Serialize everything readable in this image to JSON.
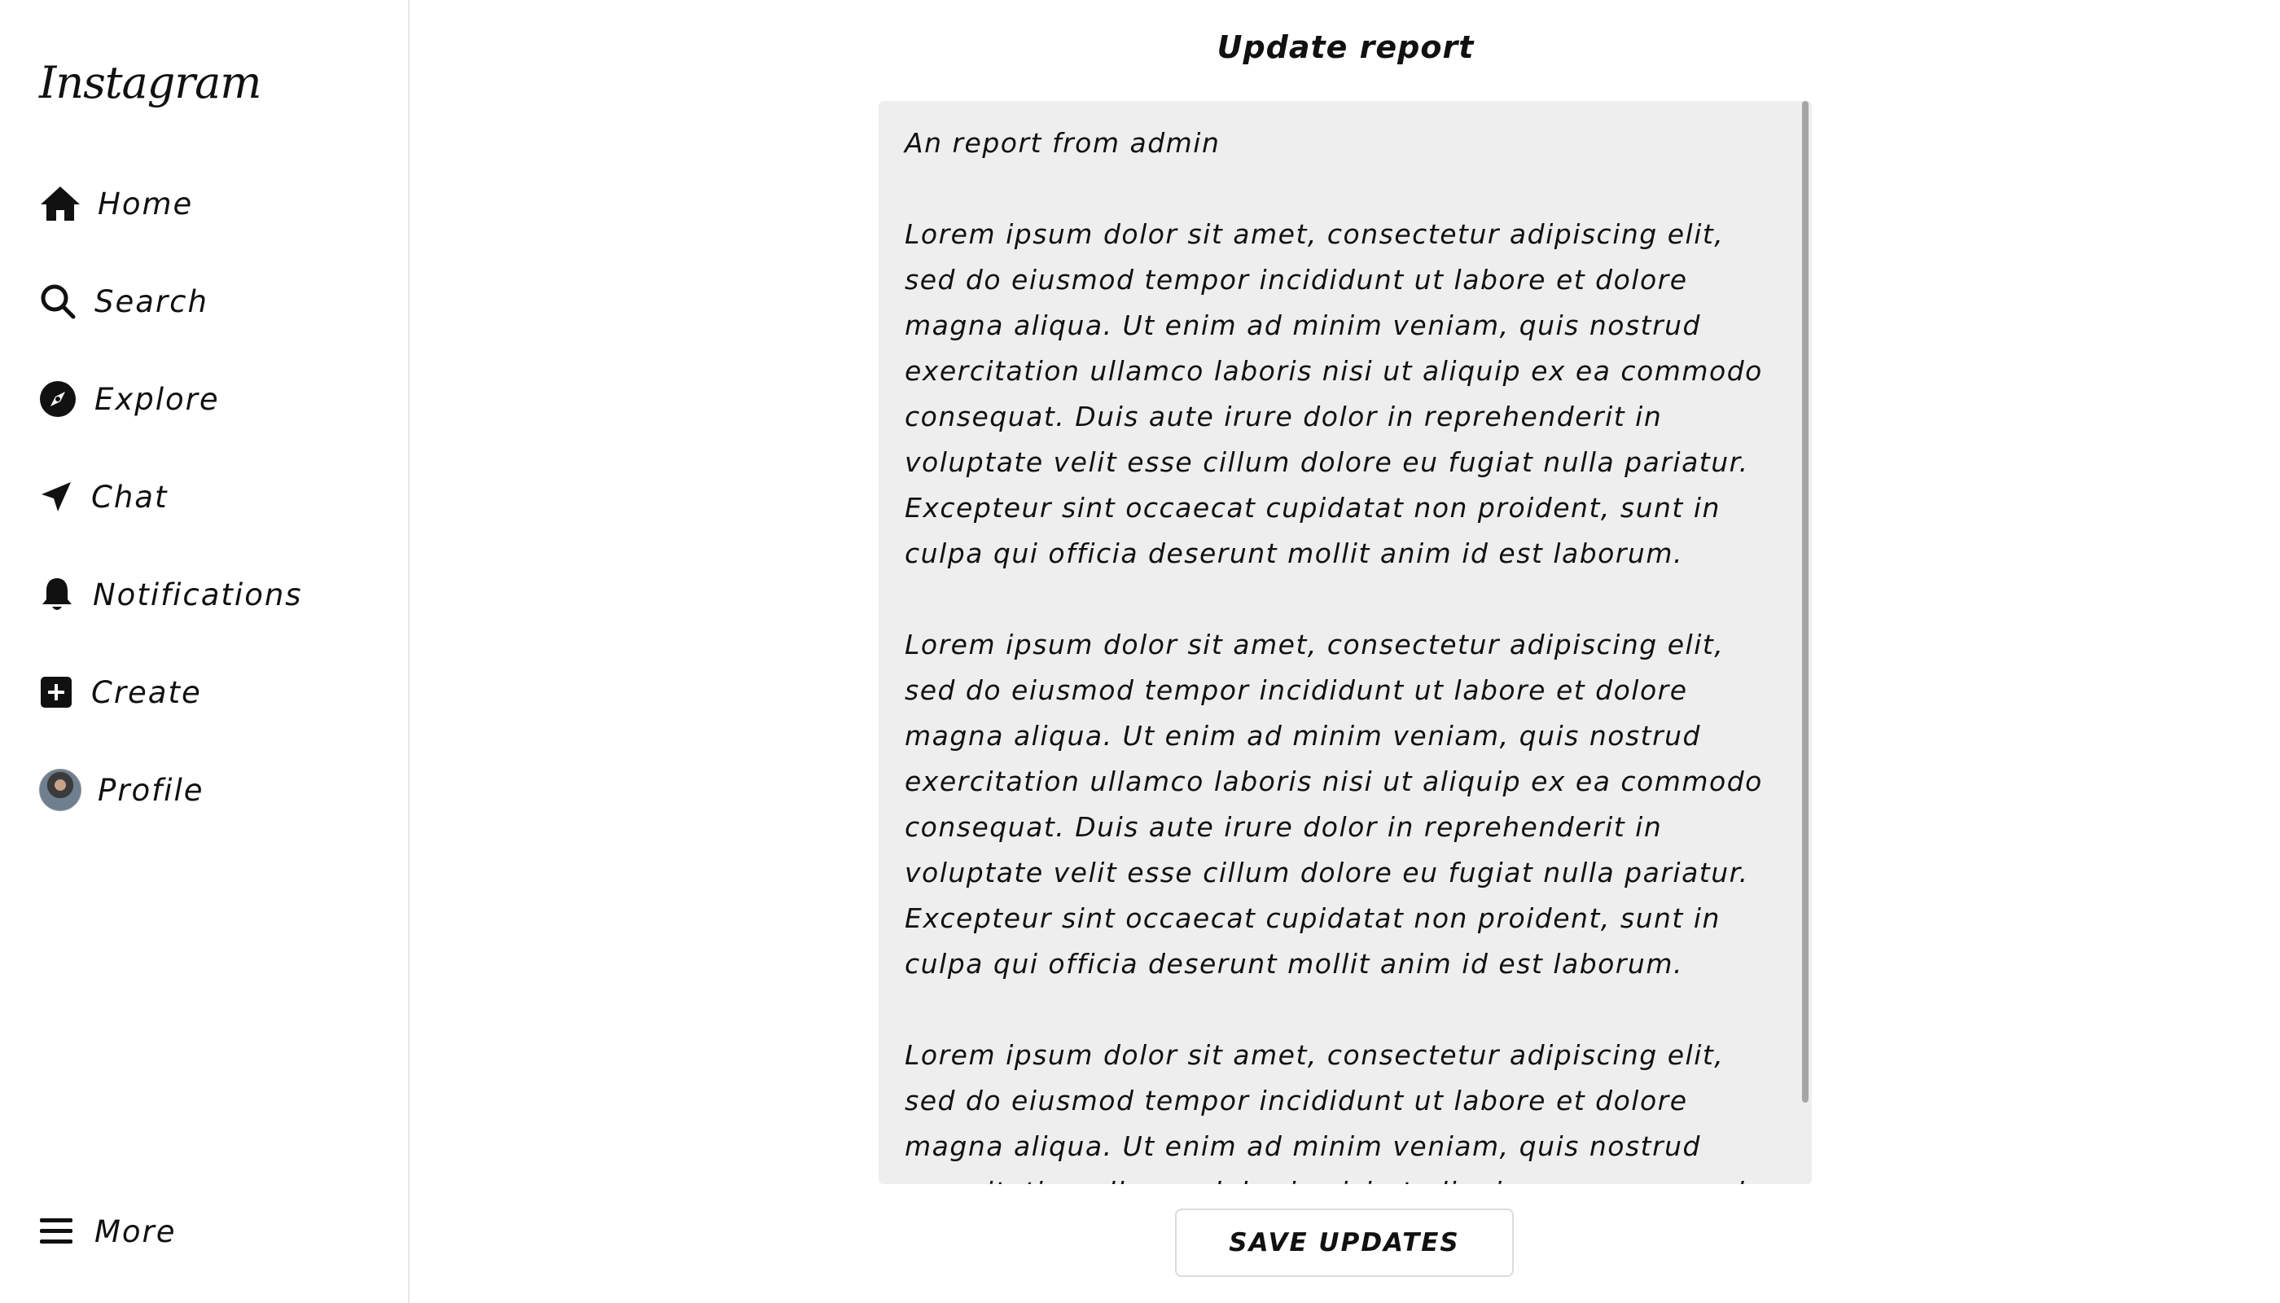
{
  "app": {
    "logo_text": "Instagram"
  },
  "sidebar": {
    "items": [
      {
        "label": "Home",
        "icon": "home-icon"
      },
      {
        "label": "Search",
        "icon": "search-icon"
      },
      {
        "label": "Explore",
        "icon": "compass-icon"
      },
      {
        "label": "Chat",
        "icon": "send-icon"
      },
      {
        "label": "Notifications",
        "icon": "bell-icon"
      },
      {
        "label": "Create",
        "icon": "plus-square-icon"
      },
      {
        "label": "Profile",
        "icon": "avatar"
      }
    ],
    "more": {
      "label": "More",
      "icon": "menu-icon"
    }
  },
  "main": {
    "title": "Update report",
    "report_text": "An report from admin\n\nLorem ipsum dolor sit amet, consectetur adipiscing elit, sed do eiusmod tempor incididunt ut labore et dolore magna aliqua. Ut enim ad minim veniam, quis nostrud exercitation ullamco laboris nisi ut aliquip ex ea commodo consequat. Duis aute irure dolor in reprehenderit in voluptate velit esse cillum dolore eu fugiat nulla pariatur. Excepteur sint occaecat cupidatat non proident, sunt in culpa qui officia deserunt mollit anim id est laborum.\n\nLorem ipsum dolor sit amet, consectetur adipiscing elit, sed do eiusmod tempor incididunt ut labore et dolore magna aliqua. Ut enim ad minim veniam, quis nostrud exercitation ullamco laboris nisi ut aliquip ex ea commodo consequat. Duis aute irure dolor in reprehenderit in voluptate velit esse cillum dolore eu fugiat nulla pariatur. Excepteur sint occaecat cupidatat non proident, sunt in culpa qui officia deserunt mollit anim id est laborum.\n\nLorem ipsum dolor sit amet, consectetur adipiscing elit, sed do eiusmod tempor incididunt ut labore et dolore magna aliqua. Ut enim ad minim veniam, quis nostrud exercitation ullamco laboris nisi ut aliquip ex ea commodo consequat. Duis aute irure dolor in reprehenderit in voluptate velit esse cillum dolore eu fugiat nulla pariatur. Excepteur sint occaecat cupidatat non proident, sunt in culpa qui officia deserunt mollit anim id est laborum.",
    "save_label": "SAVE UPDATES"
  }
}
